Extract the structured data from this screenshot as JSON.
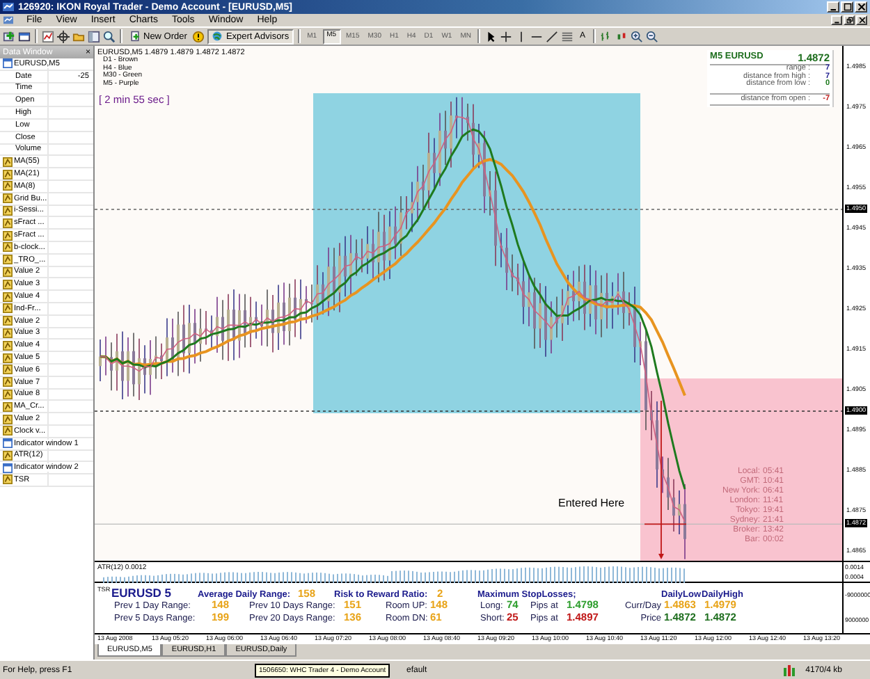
{
  "window": {
    "title": "126920: IKON Royal Trader - Demo Account - [EURUSD,M5]"
  },
  "menu": [
    "File",
    "View",
    "Insert",
    "Charts",
    "Tools",
    "Window",
    "Help"
  ],
  "toolbar": {
    "new_order": "New Order",
    "expert_advisors": "Expert Advisors",
    "text_tool": "A",
    "timeframes": [
      {
        "label": "M1",
        "selected": false
      },
      {
        "label": "M5",
        "selected": true
      },
      {
        "label": "M15",
        "selected": false
      },
      {
        "label": "M30",
        "selected": false
      },
      {
        "label": "H1",
        "selected": false
      },
      {
        "label": "H4",
        "selected": false
      },
      {
        "label": "D1",
        "selected": false
      },
      {
        "label": "W1",
        "selected": false
      },
      {
        "label": "MN",
        "selected": false
      }
    ]
  },
  "data_window": {
    "title": "Data Window",
    "close": "×",
    "rows": [
      {
        "kind": "symbol",
        "label": "EURUSD,M5"
      },
      {
        "kind": "field",
        "label": "Date",
        "value": "-25"
      },
      {
        "kind": "field",
        "label": "Time"
      },
      {
        "kind": "field",
        "label": "Open"
      },
      {
        "kind": "field",
        "label": "High"
      },
      {
        "kind": "field",
        "label": "Low"
      },
      {
        "kind": "field",
        "label": "Close"
      },
      {
        "kind": "field",
        "label": "Volume"
      },
      {
        "kind": "indicator",
        "label": "MA(55)"
      },
      {
        "kind": "indicator",
        "label": "MA(21)"
      },
      {
        "kind": "indicator",
        "label": "MA(8)"
      },
      {
        "kind": "indicator",
        "label": "Grid Bu..."
      },
      {
        "kind": "indicator",
        "label": "i-Sessi..."
      },
      {
        "kind": "indicator",
        "label": "sFract ..."
      },
      {
        "kind": "indicator",
        "label": "sFract ..."
      },
      {
        "kind": "indicator",
        "label": "b-clock..."
      },
      {
        "kind": "indicator",
        "label": "_TRO_..."
      },
      {
        "kind": "indicator",
        "label": "Value 2"
      },
      {
        "kind": "indicator",
        "label": "Value 3"
      },
      {
        "kind": "indicator",
        "label": "Value 4"
      },
      {
        "kind": "indicator",
        "label": "Ind-Fr..."
      },
      {
        "kind": "indicator",
        "label": "Value 2"
      },
      {
        "kind": "indicator",
        "label": "Value 3"
      },
      {
        "kind": "indicator",
        "label": "Value 4"
      },
      {
        "kind": "indicator",
        "label": "Value 5"
      },
      {
        "kind": "indicator",
        "label": "Value 6"
      },
      {
        "kind": "indicator",
        "label": "Value 7"
      },
      {
        "kind": "indicator",
        "label": "Value 8"
      },
      {
        "kind": "indicator",
        "label": "MA_Cr..."
      },
      {
        "kind": "indicator",
        "label": "Value 2"
      },
      {
        "kind": "indicator",
        "label": "Clock v..."
      },
      {
        "kind": "window",
        "label": "Indicator window 1"
      },
      {
        "kind": "indicator",
        "label": "ATR(12)"
      },
      {
        "kind": "window",
        "label": "Indicator window 2"
      },
      {
        "kind": "indicator",
        "label": "TSR"
      }
    ]
  },
  "chart": {
    "quote": "EURUSD,M5  1.4879 1.4879 1.4872 1.4872",
    "legend": [
      "D1 - Brown",
      "H4 - Blue",
      "M30 - Green",
      "M5 - Purple"
    ],
    "timer": "[ 2 min 55 sec ]",
    "info": {
      "title": "M5 EURUSD",
      "price": "1.4872",
      "rows": [
        {
          "label": "range :",
          "value": "7",
          "color": "#1a1a8c"
        },
        {
          "label": "distance from high :",
          "value": "7",
          "color": "#1a1a8c"
        },
        {
          "label": "distance from low :",
          "value": "0",
          "color": "#1e7a1e"
        },
        {
          "label": "distance from open :",
          "value": "-7",
          "color": "#c01818"
        }
      ]
    },
    "annotation": "Entered Here",
    "clocks": [
      {
        "label": "Local:",
        "time": "05:41"
      },
      {
        "label": "GMT:",
        "time": "10:41"
      },
      {
        "label": "New York:",
        "time": "06:41"
      },
      {
        "label": "London:",
        "time": "11:41"
      },
      {
        "label": "Tokyo:",
        "time": "19:41"
      },
      {
        "label": "Sydney:",
        "time": "21:41"
      },
      {
        "label": "Broker:",
        "time": "13:42"
      },
      {
        "label": "Bar:",
        "time": "00:02"
      }
    ],
    "price_axis": [
      {
        "text": "1.4985",
        "boxed": false
      },
      {
        "text": "1.4975",
        "boxed": false
      },
      {
        "text": "1.4965",
        "boxed": false
      },
      {
        "text": "1.4955",
        "boxed": false
      },
      {
        "text": "1.4950",
        "boxed": true
      },
      {
        "text": "1.4945",
        "boxed": false
      },
      {
        "text": "1.4935",
        "boxed": false
      },
      {
        "text": "1.4925",
        "boxed": false
      },
      {
        "text": "1.4915",
        "boxed": false
      },
      {
        "text": "1.4905",
        "boxed": false
      },
      {
        "text": "1.4900",
        "boxed": true
      },
      {
        "text": "1.4895",
        "boxed": false
      },
      {
        "text": "1.4885",
        "boxed": false
      },
      {
        "text": "1.4875",
        "boxed": false
      },
      {
        "text": "1.4872",
        "boxed": true
      },
      {
        "text": "1.4865",
        "boxed": false
      }
    ]
  },
  "atr": {
    "label": "ATR(12) 0.0012",
    "axis": [
      "0.0014",
      "0.0004"
    ]
  },
  "tsr": {
    "label": "TSR",
    "axis": [
      "-9000000",
      "9000000"
    ],
    "header": [
      {
        "kind": "title",
        "text": "EURUSD 5"
      },
      {
        "kind": "heading",
        "text": "Average Daily Range:"
      },
      {
        "kind": "value",
        "text": "158",
        "color": "#e8a317"
      },
      {
        "kind": "heading",
        "text": "Risk to Reward Ratio:"
      },
      {
        "kind": "value",
        "text": "2",
        "color": "#e8a317"
      },
      {
        "kind": "heading",
        "text": "Maximum StopLosses;"
      },
      {
        "kind": "heading",
        "text": "DailyLow"
      },
      {
        "kind": "heading",
        "text": "DailyHigh"
      }
    ],
    "rows": [
      [
        {
          "kind": "label",
          "text": "Prev 1 Day Range:"
        },
        {
          "kind": "value",
          "text": "148",
          "color": "#e8a317"
        },
        {
          "kind": "label",
          "text": "Prev 10 Days Range:"
        },
        {
          "kind": "value",
          "text": "151",
          "color": "#e8a317"
        },
        {
          "kind": "label",
          "text": "Room UP:"
        },
        {
          "kind": "value",
          "text": "148",
          "color": "#e8a317"
        },
        {
          "kind": "label",
          "text": "Long:"
        },
        {
          "kind": "value",
          "text": "74",
          "color": "#2e9e2e"
        },
        {
          "kind": "label",
          "text": "Pips at"
        },
        {
          "kind": "value",
          "text": "1.4798",
          "color": "#2e9e2e"
        },
        {
          "kind": "label",
          "text": "Curr/Day"
        },
        {
          "kind": "value",
          "text": "1.4863",
          "color": "#e8a317"
        },
        {
          "kind": "value",
          "text": "1.4979",
          "color": "#e8a317"
        }
      ],
      [
        {
          "kind": "label",
          "text": "Prev 5 Days Range:"
        },
        {
          "kind": "value",
          "text": "199",
          "color": "#e8a317"
        },
        {
          "kind": "label",
          "text": "Prev 20 Days Range:"
        },
        {
          "kind": "value",
          "text": "136",
          "color": "#e8a317"
        },
        {
          "kind": "label",
          "text": "Room DN:"
        },
        {
          "kind": "value",
          "text": "61",
          "color": "#e8a317"
        },
        {
          "kind": "label",
          "text": "Short:"
        },
        {
          "kind": "value",
          "text": "25",
          "color": "#c01818"
        },
        {
          "kind": "label",
          "text": "Pips at"
        },
        {
          "kind": "value",
          "text": "1.4897",
          "color": "#c01818"
        },
        {
          "kind": "label",
          "text": "Price"
        },
        {
          "kind": "value",
          "text": "1.4872",
          "color": "#1e6e1e"
        },
        {
          "kind": "value",
          "text": "1.4872",
          "color": "#1e6e1e"
        }
      ]
    ]
  },
  "time_axis": [
    "13 Aug 2008",
    "13 Aug 05:20",
    "13 Aug 06:00",
    "13 Aug 06:40",
    "13 Aug 07:20",
    "13 Aug 08:00",
    "13 Aug 08:40",
    "13 Aug 09:20",
    "13 Aug 10:00",
    "13 Aug 10:40",
    "13 Aug 11:20",
    "13 Aug 12:00",
    "13 Aug 12:40",
    "13 Aug 13:20"
  ],
  "tabs": [
    {
      "label": "EURUSD,M5",
      "selected": true
    },
    {
      "label": "EURUSD,H1",
      "selected": false
    },
    {
      "label": "EURUSD,Daily",
      "selected": false
    }
  ],
  "status_bar": {
    "help": "For Help, press F1",
    "tooltip": "1506650: WHC Trader 4 - Demo Account",
    "profile": "efault",
    "traffic": "4170/4 kb"
  }
}
